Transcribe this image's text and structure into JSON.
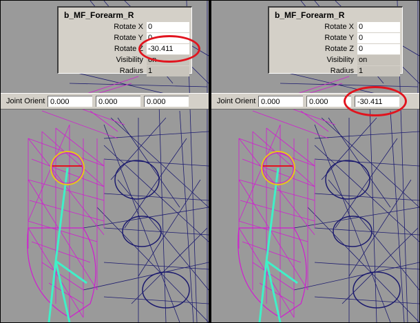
{
  "panels": [
    {
      "id": "left",
      "joint_name": "b_MF_Forearm_R",
      "attributes": [
        {
          "label": "Rotate X",
          "value": "0",
          "editable": true
        },
        {
          "label": "Rotate Y",
          "value": "0",
          "editable": true
        },
        {
          "label": "Rotate Z",
          "value": "-30.411",
          "editable": true
        },
        {
          "label": "Visibility",
          "value": "on",
          "editable": false
        },
        {
          "label": "Radius",
          "value": "1",
          "editable": false
        }
      ],
      "joint_orient_label": "Joint Orient",
      "joint_orient": [
        "0.000",
        "0.000",
        "0.000"
      ],
      "highlight": "Rotate Z"
    },
    {
      "id": "right",
      "joint_name": "b_MF_Forearm_R",
      "attributes": [
        {
          "label": "Rotate X",
          "value": "0",
          "editable": true
        },
        {
          "label": "Rotate Y",
          "value": "0",
          "editable": true
        },
        {
          "label": "Rotate Z",
          "value": "0",
          "editable": true
        },
        {
          "label": "Visibility",
          "value": "on",
          "editable": false
        },
        {
          "label": "Radius",
          "value": "1",
          "editable": false
        }
      ],
      "joint_orient_label": "Joint Orient",
      "joint_orient": [
        "0.000",
        "0.000",
        "-30.411"
      ],
      "highlight": "Joint Orient Z"
    }
  ],
  "colors": {
    "viewport_bg": "#9a9a9a",
    "panel_bg": "#d4d0c8",
    "highlight_ellipse": "#e1141e",
    "wire_magenta": "#d11bd1",
    "wire_navy": "#1b1a6e",
    "joint_cyan": "#3ff0c8",
    "joint_select": "#e8c31a"
  },
  "icons": [
    "joint-icon",
    "highlight-ellipse"
  ]
}
